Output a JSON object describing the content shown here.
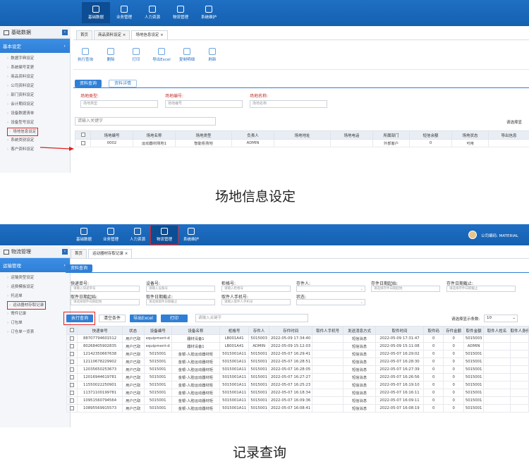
{
  "top_nav": [
    "基础数据",
    "业务管理",
    "人力资源",
    "物流管理",
    "系统维护"
  ],
  "s1": {
    "side_title": "基础数据",
    "group": "基本设定",
    "menu": [
      "数据字典设定",
      "系统编号变更",
      "商品资料设定",
      "公司资料设定",
      "部门资料设定",
      "会计期间设定",
      "设备数据清单",
      "设备型号设定",
      "场地信息设定",
      "系统类别设定",
      "客户资料设定"
    ],
    "tabs": [
      "首页",
      "商品资料设定 ×",
      "场地信息设定 ×"
    ],
    "tools": [
      "执行查询",
      "删除",
      "打印",
      "导出Excel",
      "复制明细",
      "刷新"
    ],
    "subtabs": [
      "资料查询",
      "资料详情"
    ],
    "fields": [
      {
        "label": "场地类型:",
        "ph": "场地类型"
      },
      {
        "label": "场地编号:",
        "ph": "场地编号"
      },
      {
        "label": "场地名称:",
        "ph": "场地名称"
      }
    ],
    "kw_placeholder": "请输入关键字",
    "page_size_label": "请选择显",
    "headers": [
      "场地编号",
      "场地名称",
      "场地类型",
      "负责人",
      "场地地址",
      "场地电话",
      "所属部门",
      "短信余额",
      "场地状态",
      "导出信息"
    ],
    "rows": [
      [
        "0002",
        "运动器材场地1",
        "智能柜场地",
        "ADMIN",
        "",
        "",
        "外部客户",
        "0",
        "可用",
        ""
      ]
    ]
  },
  "caption1": "场地信息设定",
  "s2": {
    "company": "公司编码: MATERIAL",
    "side_title": "物流管理",
    "group": "运输管理",
    "menu": [
      "运输类型设定",
      "运费模板设定",
      "托运单",
      "运动器材存取记录",
      "寄件记录",
      "订包单",
      "订仓单一览表"
    ],
    "tabs": [
      "首页",
      "运动器材存取记录 ×"
    ],
    "subtab": "资料查询",
    "fields": [
      {
        "label": "快递单号:",
        "ph": "请输入快递单号"
      },
      {
        "label": "设备号:",
        "ph": "请输入设备号"
      },
      {
        "label": "柜格号:",
        "ph": "请输入柜格号"
      },
      {
        "label": "存件人:",
        "ph": ""
      },
      {
        "label": "存件日期起始:",
        "ph": "请选择存件日期起始"
      },
      {
        "label": "存件日期截止:",
        "ph": "请选择存件日期截止"
      },
      {
        "label": "取件日期起始:",
        "ph": "请选择取件日期起始"
      },
      {
        "label": "取件日期截止:",
        "ph": "请选择取件日期截止"
      },
      {
        "label": "取件人手机号:",
        "ph": "请输入取件人手机号"
      },
      {
        "label": "状态:",
        "ph": ""
      }
    ],
    "buttons": [
      "执行查询",
      "清空条件",
      "导出Excel",
      "打印"
    ],
    "kw_placeholder": "请输入关键字",
    "page_size_label": "请选择显示条数:",
    "page_size": "10",
    "headers": [
      "快递单号",
      "状态",
      "设备编号",
      "设备名称",
      "柜格号",
      "存件人",
      "存件时间",
      "取件人手机号",
      "发送消息方式",
      "取件时间",
      "取件码",
      "存件金额",
      "取件金额",
      "取件人姓名",
      "取件人身份"
    ],
    "rows": [
      [
        "88707794601512",
        "用户已取",
        "equipment-d",
        "器材设备1",
        "LB001A41",
        "5015003",
        "2022-05-09 17:34:40",
        "",
        "短信消息",
        "2022-05-09 17:31:47",
        "0",
        "0",
        "5015003",
        ""
      ],
      [
        "80268405902835",
        "用户已取",
        "equipment-d",
        "器材设备1",
        "LB001A41",
        "ADMIN",
        "2022-05-09 15:12:03",
        "",
        "短信消息",
        "2022-05-09 15:11:08",
        "0",
        "0",
        "ADMIN",
        ""
      ],
      [
        "12142350667638",
        "用户已取",
        "5015001",
        "金银-人脸运动器材柜",
        "5015001A11",
        "5015001",
        "2022-05-07 16:29:41",
        "",
        "短信消息",
        "2022-05-07 16:29:02",
        "0",
        "0",
        "5015001",
        ""
      ],
      [
        "12110678229902",
        "用户已取",
        "5015001",
        "金银-人脸运动器材柜",
        "5015001A11",
        "5015001",
        "2022-05-07 16:28:51",
        "",
        "短信消息",
        "2022-05-07 16:28:30",
        "0",
        "0",
        "5015001",
        ""
      ],
      [
        "12035650253673",
        "用户已取",
        "5015001",
        "金银-人脸运动器材柜",
        "5015001A11",
        "5015001",
        "2022-05-07 16:28:05",
        "",
        "短信消息",
        "2022-05-07 16:27:39",
        "0",
        "0",
        "5015001",
        ""
      ],
      [
        "12016944619781",
        "用户已取",
        "5015001",
        "金银-人脸运动器材柜",
        "5015001A11",
        "5015001",
        "2022-05-07 16:27:27",
        "",
        "短信消息",
        "2022-05-07 16:26:56",
        "0",
        "0",
        "5015001",
        ""
      ],
      [
        "11550022250901",
        "用户已取",
        "5015001",
        "金银-人脸运动器材柜",
        "5015001A11",
        "5015001",
        "2022-05-07 16:25:23",
        "",
        "短信消息",
        "2022-05-07 16:19:10",
        "0",
        "0",
        "5015001",
        ""
      ],
      [
        "11371100199781",
        "用户已取",
        "5015001",
        "金银-人脸运动器材柜",
        "5015001A11",
        "5015001",
        "2022-05-07 16:18:34",
        "",
        "短信消息",
        "2022-05-07 16:16:11",
        "0",
        "0",
        "5015001",
        ""
      ],
      [
        "10951560794564",
        "用户已取",
        "5015001",
        "金银-人脸运动器材柜",
        "5015001A11",
        "5015001",
        "2022-05-07 16:09:36",
        "",
        "短信消息",
        "2022-05-07 16:09:11",
        "0",
        "0",
        "5015001",
        ""
      ],
      [
        "10895569915573",
        "用户已取",
        "5015001",
        "金银-人脸运动器材柜",
        "5015001A11",
        "5015001",
        "2022-05-07 16:08:41",
        "",
        "短信消息",
        "2022-05-07 16:08:19",
        "0",
        "0",
        "5015001",
        ""
      ]
    ]
  },
  "caption2": "记录查询"
}
